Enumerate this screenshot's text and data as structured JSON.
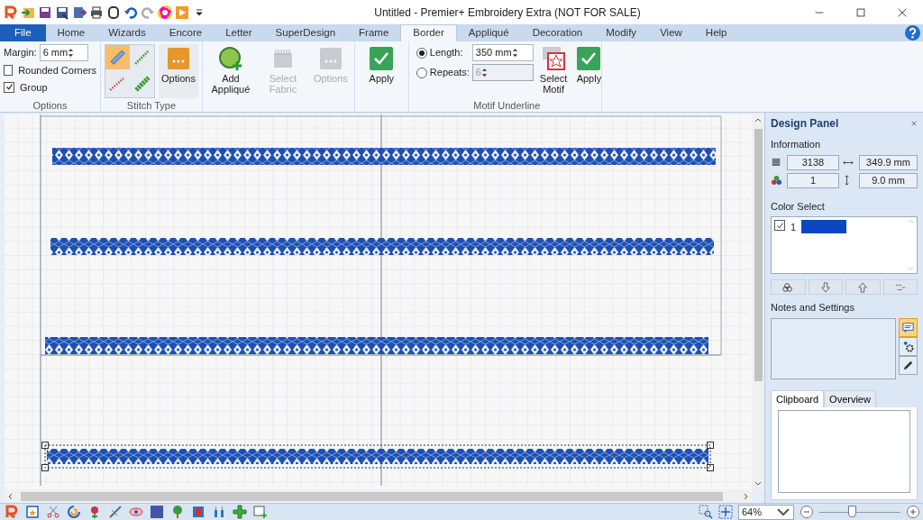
{
  "window": {
    "title": "Untitled - Premier+ Embroidery Extra (NOT FOR SALE)"
  },
  "ribbon_tabs": [
    {
      "label": "File",
      "kind": "file",
      "selected": false
    },
    {
      "label": "Home",
      "kind": "tab",
      "selected": false
    },
    {
      "label": "Wizards",
      "kind": "tab",
      "selected": false
    },
    {
      "label": "Encore",
      "kind": "tab",
      "selected": false
    },
    {
      "label": "Letter",
      "kind": "tab",
      "selected": false
    },
    {
      "label": "SuperDesign",
      "kind": "tab",
      "selected": false
    },
    {
      "label": "Frame",
      "kind": "tab",
      "selected": false
    },
    {
      "label": "Border",
      "kind": "tab",
      "selected": true
    },
    {
      "label": "Appliqué",
      "kind": "tab",
      "selected": false
    },
    {
      "label": "Decoration",
      "kind": "tab",
      "selected": false
    },
    {
      "label": "Modify",
      "kind": "tab",
      "selected": false
    },
    {
      "label": "View",
      "kind": "tab",
      "selected": false
    },
    {
      "label": "Help",
      "kind": "tab",
      "selected": false
    }
  ],
  "options_group": {
    "label": "Options",
    "margin": {
      "label": "Margin:",
      "value": "6 mm"
    },
    "checkboxes": [
      {
        "label": "Rounded Corners",
        "checked": false
      },
      {
        "label": "Group",
        "checked": true
      }
    ]
  },
  "stitch_type_group": {
    "label": "Stitch Type",
    "stitches": [
      {
        "selected": true
      },
      {
        "selected": false
      },
      {
        "selected": false
      },
      {
        "selected": false
      }
    ],
    "options": "Options"
  },
  "applique_group": {
    "buttons": [
      {
        "label": "Add Appliqué",
        "disabled": false
      },
      {
        "label": "Select Fabric",
        "disabled": true
      },
      {
        "label": "Options",
        "disabled": true
      }
    ]
  },
  "apply_button": "Apply",
  "motif_underline_group": {
    "label": "Motif Underline",
    "modes": [
      {
        "label": "Length:",
        "value": "350 mm",
        "selected": true
      },
      {
        "label": "Repeats:",
        "value": "6",
        "selected": false
      }
    ],
    "select_motif": "Select Motif",
    "apply": "Apply"
  },
  "canvas": {
    "borders": [
      {
        "selected": false
      },
      {
        "selected": false
      },
      {
        "selected": false
      },
      {
        "selected": true
      }
    ]
  },
  "design_panel": {
    "title": "Design Panel",
    "information": {
      "label": "Information",
      "stitches": "3138",
      "colors": "1",
      "width": "349.9 mm",
      "height": "9.0 mm"
    },
    "color_select": {
      "label": "Color Select",
      "colors": [
        {
          "number": "1",
          "checked": true,
          "color": "#0b48c0"
        }
      ]
    },
    "notes_label": "Notes and Settings",
    "tabs": [
      {
        "label": "Clipboard",
        "selected": true
      },
      {
        "label": "Overview",
        "selected": false
      }
    ]
  },
  "status_bar": {
    "zoom": "64%",
    "zoom_slider": {
      "level": 0.4
    }
  }
}
